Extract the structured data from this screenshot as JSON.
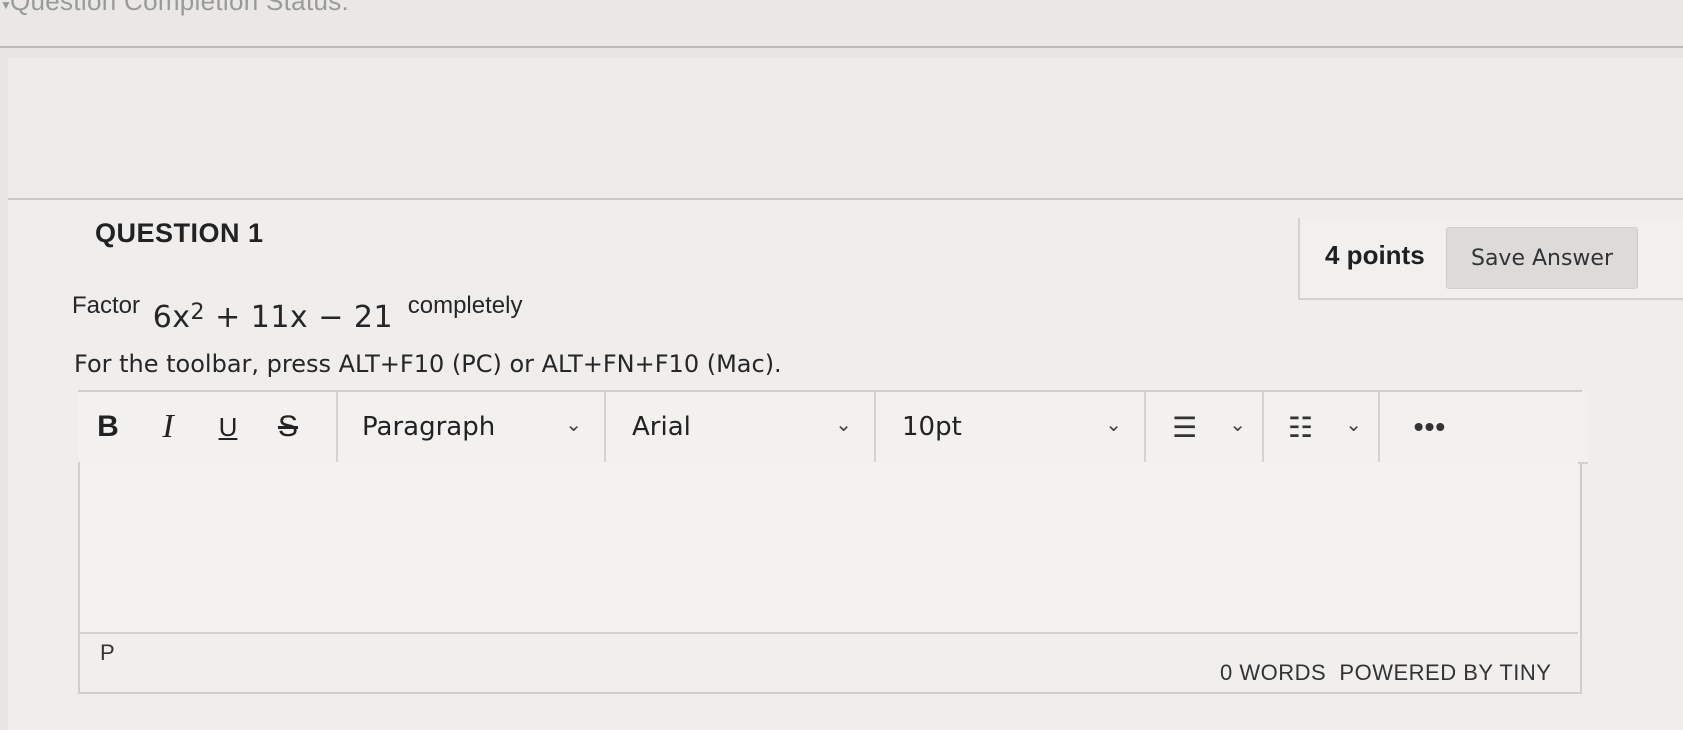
{
  "header": {
    "status_label": "Question Completion Status:"
  },
  "question": {
    "title": "QUESTION 1",
    "points": "4 points",
    "save_label": "Save Answer",
    "prompt_prefix": "Factor",
    "expression_base": "6x",
    "expression_exponent": "2",
    "expression_rest": "+ 11x − 21",
    "prompt_suffix": "completely",
    "hint": "For the toolbar, press ALT+F10 (PC) or ALT+FN+F10 (Mac)."
  },
  "toolbar": {
    "bold": "B",
    "italic": "I",
    "underline": "U",
    "strikethrough": "S",
    "block_format": "Paragraph",
    "font_family": "Arial",
    "font_size": "10pt",
    "more": "•••"
  },
  "statusbar": {
    "path": "P",
    "word_count": "0 WORDS",
    "powered_by": "POWERED BY TINY"
  }
}
